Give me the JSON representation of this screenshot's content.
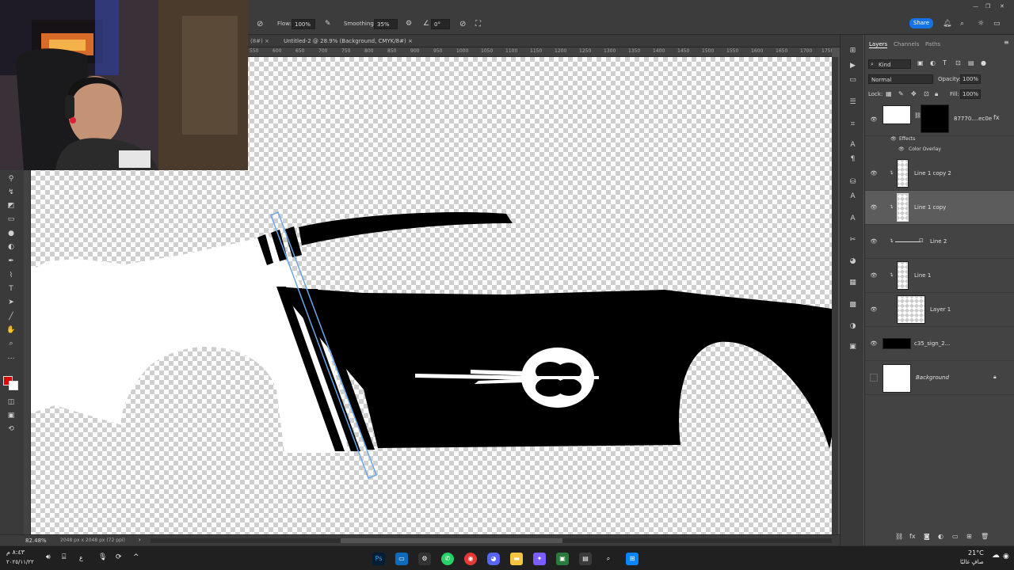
{
  "options_bar": {
    "flow_label": "Flow:",
    "flow_value": "100%",
    "smoothing_label": "Smoothing:",
    "smoothing_value": "35%",
    "angle_value": "0°",
    "share_label": "Share"
  },
  "tabs": [
    {
      "label": "(8#) ×"
    },
    {
      "label": "Untitled-2 @ 28.9% (Background, CMYK/8#) ×"
    }
  ],
  "ruler": {
    "ticks": [
      "550",
      "600",
      "650",
      "700",
      "750",
      "800",
      "850",
      "900",
      "950",
      "1000",
      "1050",
      "1100",
      "1150",
      "1200",
      "1250",
      "1300",
      "1350",
      "1400",
      "1450",
      "1500",
      "1550",
      "1600",
      "1650",
      "1700",
      "1750"
    ]
  },
  "status": {
    "zoom": "82.48%",
    "doc_info": "2048 px x 2048 px (72 ppi)"
  },
  "panel": {
    "tabs": {
      "layers": "Layers",
      "channels": "Channels",
      "paths": "Paths"
    },
    "filter_label": "Kind",
    "blend_mode": "Normal",
    "opacity_label": "Opacity:",
    "opacity_value": "100%",
    "lock_label": "Lock:",
    "fill_label": "Fill:",
    "fill_value": "100%",
    "fx_label": "fx",
    "layers": [
      {
        "name": "87770....ec0e"
      },
      {
        "name": "Line 1 copy 2"
      },
      {
        "name": "Line 1 copy"
      },
      {
        "name": "Line 2"
      },
      {
        "name": "Line 1"
      },
      {
        "name": "Layer 1"
      },
      {
        "name": "c35_sign_2..."
      },
      {
        "name": "Background"
      }
    ],
    "effects_label": "Effects",
    "color_overlay_label": "Color Overlay"
  },
  "taskbar": {
    "time": "٨:٤٣ م",
    "date": "٢٠٢٥/١١/٢٢",
    "temperature": "21°C",
    "weather": "صافٍ غالبًا",
    "lang": "ع"
  },
  "colors": {
    "accent": "#1473e6",
    "foreground_swatch": "#e00000",
    "panel_bg": "#434343"
  }
}
